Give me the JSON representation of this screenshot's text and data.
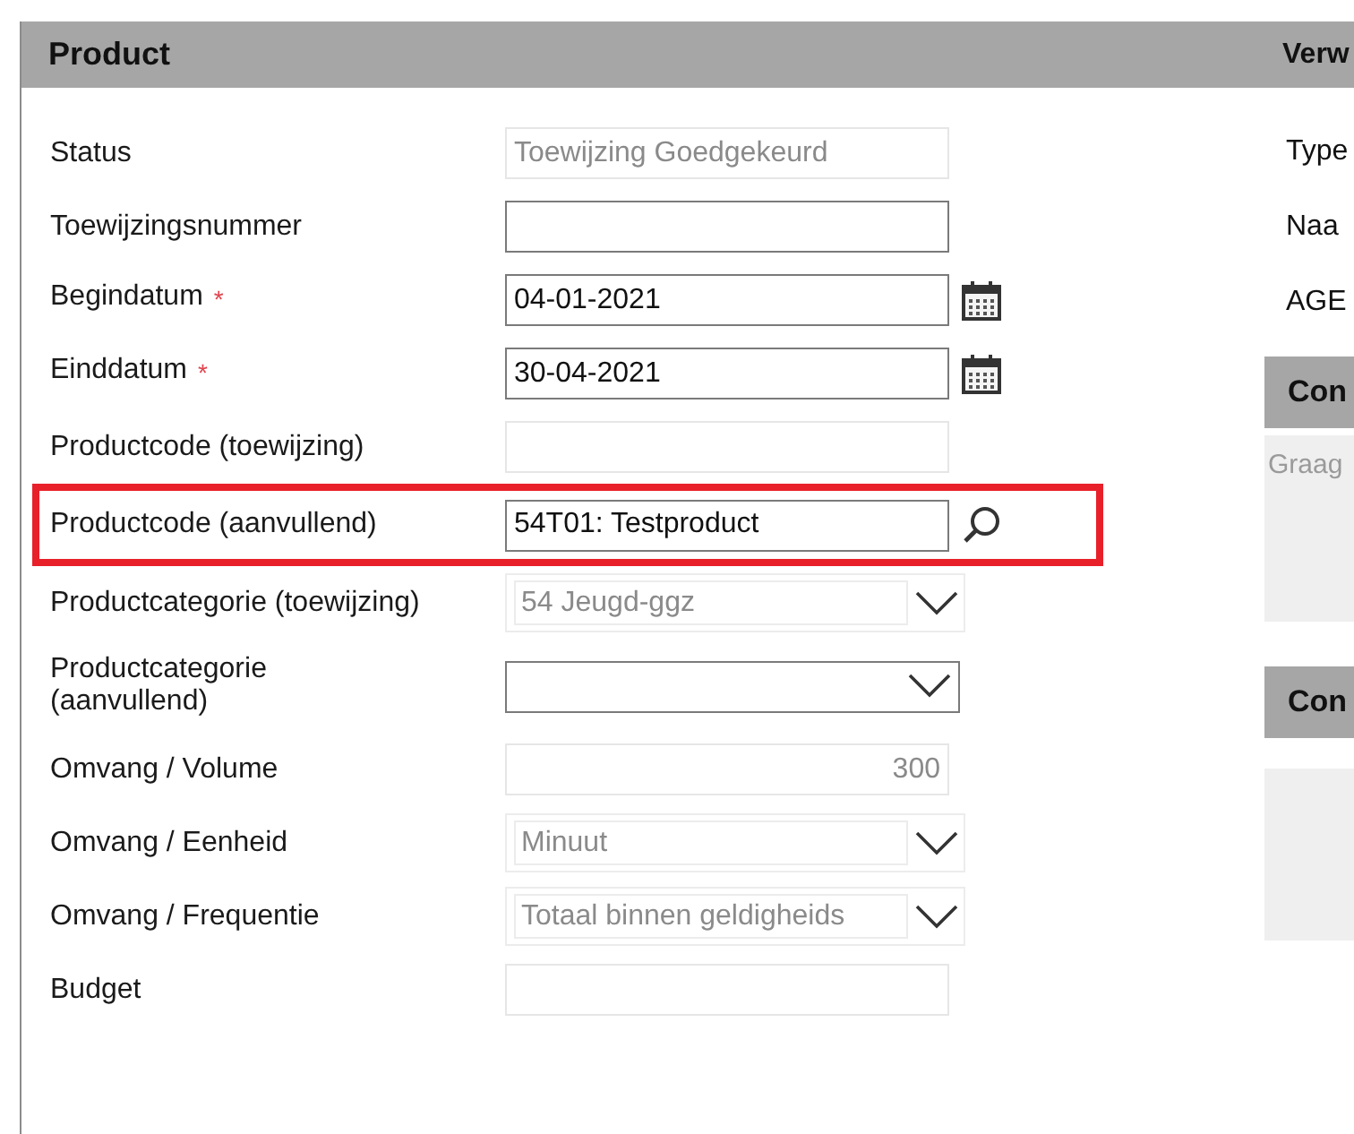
{
  "product_panel": {
    "title": "Product",
    "rows": [
      {
        "label": "Status",
        "kind": "text",
        "value": "Toewijzing Goedgekeurd",
        "disabled": true,
        "highlighted": false
      },
      {
        "label": "Toewijzingsnummer",
        "kind": "text",
        "value": "",
        "disabled": false,
        "highlighted": false
      },
      {
        "label": "Begindatum",
        "marker": "*",
        "kind": "date",
        "value": "04-01-2021",
        "disabled": false,
        "highlighted": false
      },
      {
        "label": "Einddatum",
        "marker": "*",
        "kind": "date",
        "value": "30-04-2021",
        "disabled": false,
        "highlighted": false
      },
      {
        "label": "Productcode (toewijzing)",
        "kind": "text",
        "value": "",
        "disabled": true,
        "highlighted": false
      },
      {
        "label": "Productcode (aanvullend)",
        "kind": "lookup",
        "value": "54T01: Testproduct",
        "disabled": false,
        "highlighted": true
      },
      {
        "label": "Productcategorie (toewijzing)",
        "kind": "select",
        "value": "54 Jeugd-ggz",
        "disabled": true,
        "highlighted": false
      },
      {
        "label": "Productcategorie (aanvullend)",
        "wrapped": true,
        "kind": "select",
        "value": "",
        "disabled": false,
        "highlighted": false
      },
      {
        "label": "Omvang / Volume",
        "kind": "number",
        "value": "300",
        "disabled": true,
        "highlighted": false
      },
      {
        "label": "Omvang / Eenheid",
        "kind": "select",
        "value": "Minuut",
        "disabled": true,
        "highlighted": false
      },
      {
        "label": "Omvang / Frequentie",
        "kind": "select",
        "value": "Totaal binnen geldigheids",
        "disabled": true,
        "highlighted": false
      },
      {
        "label": "Budget",
        "kind": "text",
        "value": "",
        "disabled": true,
        "highlighted": false
      }
    ]
  },
  "side_panel": {
    "title": "Verw",
    "labels": [
      "Type",
      "Naa",
      "AGE"
    ],
    "sections": [
      {
        "title": "Con",
        "placeholder": "Graag"
      },
      {
        "title": "Con"
      }
    ]
  }
}
